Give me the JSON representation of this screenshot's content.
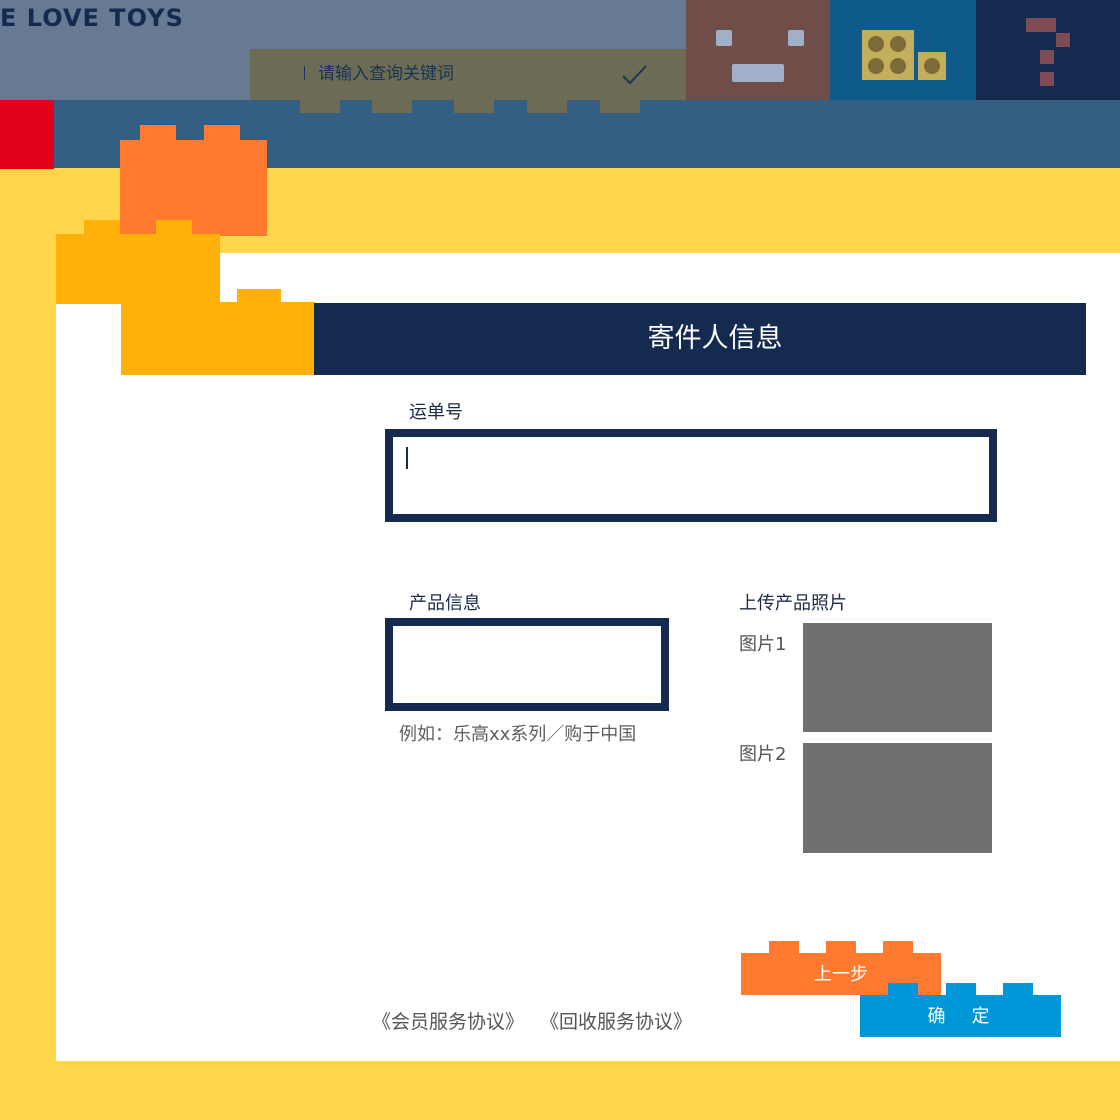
{
  "header": {
    "brand_text": "E LOVE TOYS",
    "search_placeholder": "请输入查询关键词"
  },
  "form": {
    "title": "寄件人信息",
    "waybill_label": "运单号",
    "waybill_value": "",
    "product_info_label": "产品信息",
    "product_info_value": "",
    "product_info_hint": "例如：乐高xx系列／购于中国",
    "upload_label": "上传产品照片",
    "image1_label": "图片1",
    "image2_label": "图片2"
  },
  "buttons": {
    "prev": "上一步",
    "confirm": "确　定"
  },
  "footer": {
    "member_agreement": "《会员服务协议》",
    "recycle_agreement": "《回收服务协议》"
  },
  "colors": {
    "navy": "#142B4F",
    "yellow_bg": "#FFD54A",
    "orange": "#FF7A2E",
    "blue": "#0097D8",
    "red": "#E3001B"
  }
}
